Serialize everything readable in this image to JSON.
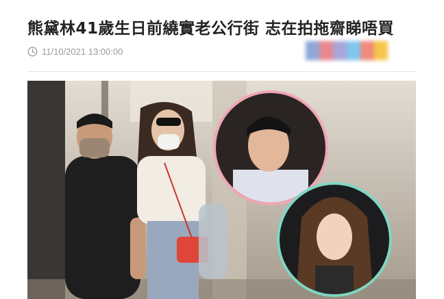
{
  "article": {
    "title": "熊黛林41歲生日前繞實老公行街 志在拍拖齋睇唔買",
    "timestamp": "11/10/2021 13:00:00"
  },
  "icons": {
    "timestamp_icon": "clock-icon"
  },
  "colors": {
    "title": "#222222",
    "meta": "#999999",
    "top_circle_ring": "#f0a6b4",
    "bottom_circle_ring": "#7fd6c2",
    "handbag": "#e0453a",
    "share_strip": [
      "#8ea7d8",
      "#e9878f",
      "#a8a6d8",
      "#7fc6f0",
      "#f08a7a",
      "#f6c64a"
    ]
  },
  "share_blocks": [
    {
      "color": "#8ea7d8"
    },
    {
      "color": "#e9878f"
    },
    {
      "color": "#a8a6d8"
    },
    {
      "color": "#7fc6f0"
    },
    {
      "color": "#f08a7a"
    },
    {
      "color": "#f6c64a"
    }
  ]
}
